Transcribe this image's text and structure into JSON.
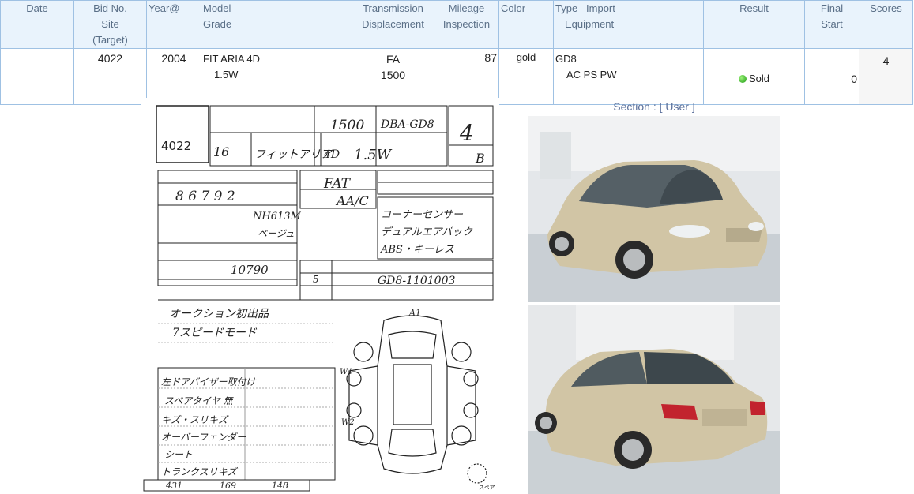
{
  "headers": {
    "date": "Date",
    "bid_no": "Bid No.",
    "site": "Site",
    "target": "(Target)",
    "year": "Year@",
    "model": "Model",
    "grade": "Grade",
    "transmission": "Transmission",
    "displacement": "Displacement",
    "mileage": "Mileage",
    "inspection": "Inspection",
    "color": "Color",
    "type_import": "Type   Import",
    "equipment": "Equipment",
    "result": "Result",
    "final": "Final",
    "start": "Start",
    "scores": "Scores"
  },
  "row": {
    "date": "",
    "bid_no": "4022",
    "year": "2004",
    "model": "FIT ARIA 4D",
    "grade": "1.5W",
    "transmission": "FA",
    "displacement": "1500",
    "mileage": "87",
    "color": "gold",
    "type": "GD8",
    "equipment": "AC PS PW",
    "result": "Sold",
    "final_start": "0",
    "scores": "4"
  },
  "section": {
    "label": "Section : [ User ]"
  },
  "sheet": {
    "lot_no": "4022",
    "displacement": "1500",
    "model_code": "DBA-GD8",
    "grade_hw": "4",
    "year_hw": "16",
    "name_hw": "フィットアリア",
    "doors_hw": "4D",
    "grade_name_hw": "1.5W",
    "interior_hw": "B",
    "mileage_hw": "8 6 7 9 2",
    "shift_hw": "FAT",
    "ac_hw": "AA/C",
    "color_code_hw": "NH613M",
    "color_name_hw": "ベージュ",
    "recycle_hw": "10790",
    "capacity_hw": "5",
    "chassis_hw": "GD8-1101003",
    "sales_points": [
      "コーナーセンサー",
      "デュアルエアバック",
      "ABS・キーレス"
    ],
    "notes": [
      "オークション初出品",
      "7スピードモード"
    ],
    "report": [
      "左ドアバイザー取付け",
      "スペアタイヤ 無",
      "キズ・スリキズ",
      "オーバーフェンダー",
      "シート",
      "トランクスリキズ"
    ],
    "length_hw": "431",
    "width_hw": "169",
    "height_hw": "148",
    "mark_a1": "A1",
    "mark_w1": "W1",
    "mark_w2": "W2",
    "spare_label": "スペア"
  },
  "colors": {
    "header_bg": "#e9f3fc",
    "border": "#9fc1e3",
    "header_text": "#5a6f87",
    "sold_dot": "#2fb61f",
    "car_body": "#cfc2a2"
  }
}
